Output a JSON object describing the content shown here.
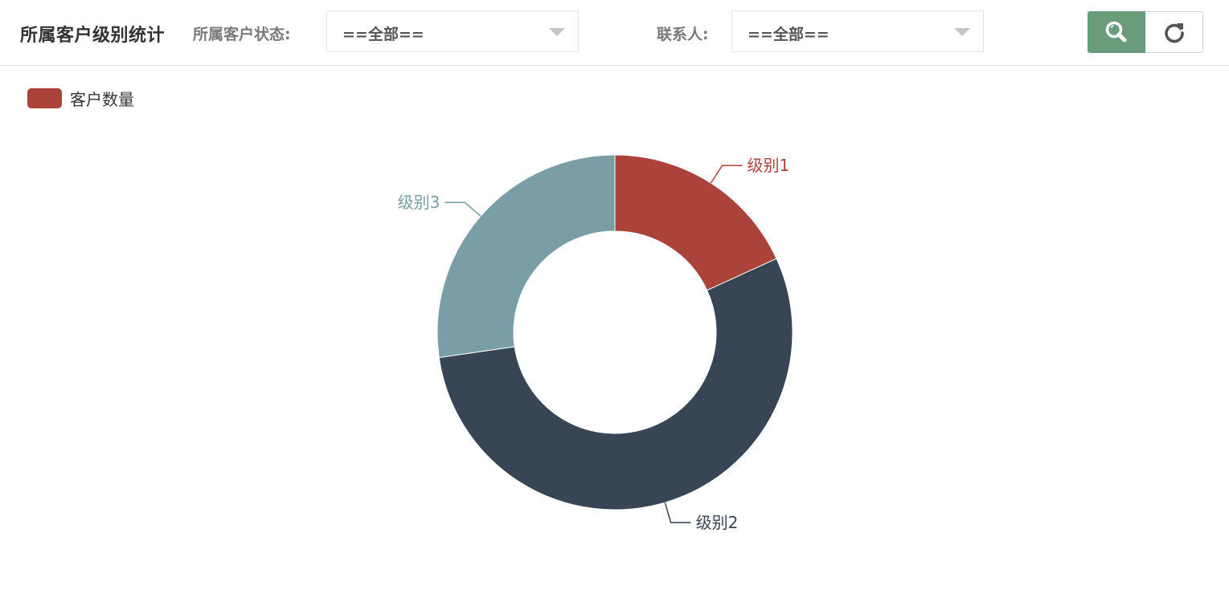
{
  "header": {
    "title": "所属客户级别统计",
    "status_label": "所属客户状态:",
    "status_value": "==全部==",
    "contact_label": "联系人:",
    "contact_value": "==全部=="
  },
  "icons": {
    "search": "search-icon",
    "refresh": "refresh-icon",
    "dropdown": "chevron-down-icon"
  },
  "colors": {
    "search_button": "#6a9b7b",
    "level1": "#ac433b",
    "level2": "#374555",
    "level3": "#799ea5"
  },
  "chart_data": {
    "type": "pie",
    "variant": "donut",
    "legend": [
      "客户数量"
    ],
    "legend_position": "top-left",
    "series": [
      {
        "name": "客户数量",
        "data": [
          {
            "label": "级别1",
            "value": 1,
            "color": "#ac433b"
          },
          {
            "label": "级别2",
            "value": 3,
            "color": "#374555"
          },
          {
            "label": "级别3",
            "value": 1.5,
            "color": "#799ea5"
          }
        ]
      }
    ]
  }
}
